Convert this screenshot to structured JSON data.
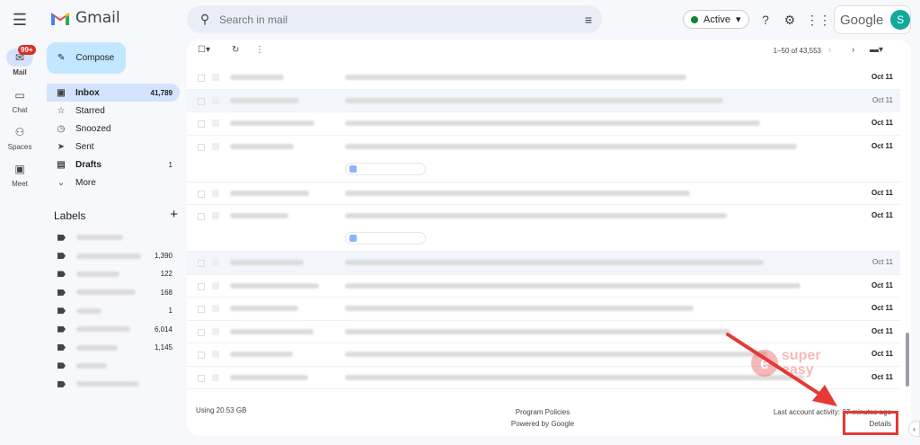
{
  "app": {
    "logo_text": "Gmail"
  },
  "search": {
    "placeholder": "Search in mail"
  },
  "status": {
    "label": "Active"
  },
  "account": {
    "brand": "Google",
    "avatar_initial": "S"
  },
  "rail": {
    "badge": "99+",
    "items": [
      {
        "label": "Mail",
        "icon": "mail-icon"
      },
      {
        "label": "Chat",
        "icon": "chat-icon"
      },
      {
        "label": "Spaces",
        "icon": "spaces-icon"
      },
      {
        "label": "Meet",
        "icon": "meet-icon"
      }
    ]
  },
  "compose": {
    "label": "Compose"
  },
  "nav": [
    {
      "label": "Inbox",
      "count": "41,789",
      "icon": "inbox-icon"
    },
    {
      "label": "Starred",
      "count": "",
      "icon": "star-icon"
    },
    {
      "label": "Snoozed",
      "count": "",
      "icon": "clock-icon"
    },
    {
      "label": "Sent",
      "count": "",
      "icon": "send-icon"
    },
    {
      "label": "Drafts",
      "count": "1",
      "icon": "draft-icon"
    },
    {
      "label": "More",
      "count": "",
      "icon": "chevron-down-icon"
    }
  ],
  "labels": {
    "title": "Labels",
    "counts": [
      "",
      "1,390",
      "122",
      "168",
      "1",
      "6,014",
      "1,145",
      "",
      ""
    ]
  },
  "toolbar": {
    "pager": "1–50 of 43,553"
  },
  "rows": [
    {
      "date": "Oct 11",
      "read": false,
      "tall": false
    },
    {
      "date": "Oct 11",
      "read": true,
      "tall": false
    },
    {
      "date": "Oct 11",
      "read": false,
      "tall": false
    },
    {
      "date": "Oct 11",
      "read": false,
      "tall": true
    },
    {
      "date": "Oct 11",
      "read": false,
      "tall": false
    },
    {
      "date": "Oct 11",
      "read": false,
      "tall": true
    },
    {
      "date": "Oct 11",
      "read": true,
      "tall": false
    },
    {
      "date": "Oct 11",
      "read": false,
      "tall": false
    },
    {
      "date": "Oct 11",
      "read": false,
      "tall": false
    },
    {
      "date": "Oct 11",
      "read": false,
      "tall": false
    },
    {
      "date": "Oct 11",
      "read": false,
      "tall": false
    },
    {
      "date": "Oct 11",
      "read": false,
      "tall": false
    }
  ],
  "footer": {
    "storage": "Using 20.53 GB",
    "policies": "Program Policies",
    "powered": "Powered by Google",
    "activity": "Last account activity: 37 minutes ago",
    "details": "Details"
  },
  "watermark": {
    "line1": "super",
    "line2": "easy"
  },
  "colors": {
    "accent": "#c2e7ff",
    "highlight": "#e53935",
    "active_nav": "#d3e3fd"
  }
}
